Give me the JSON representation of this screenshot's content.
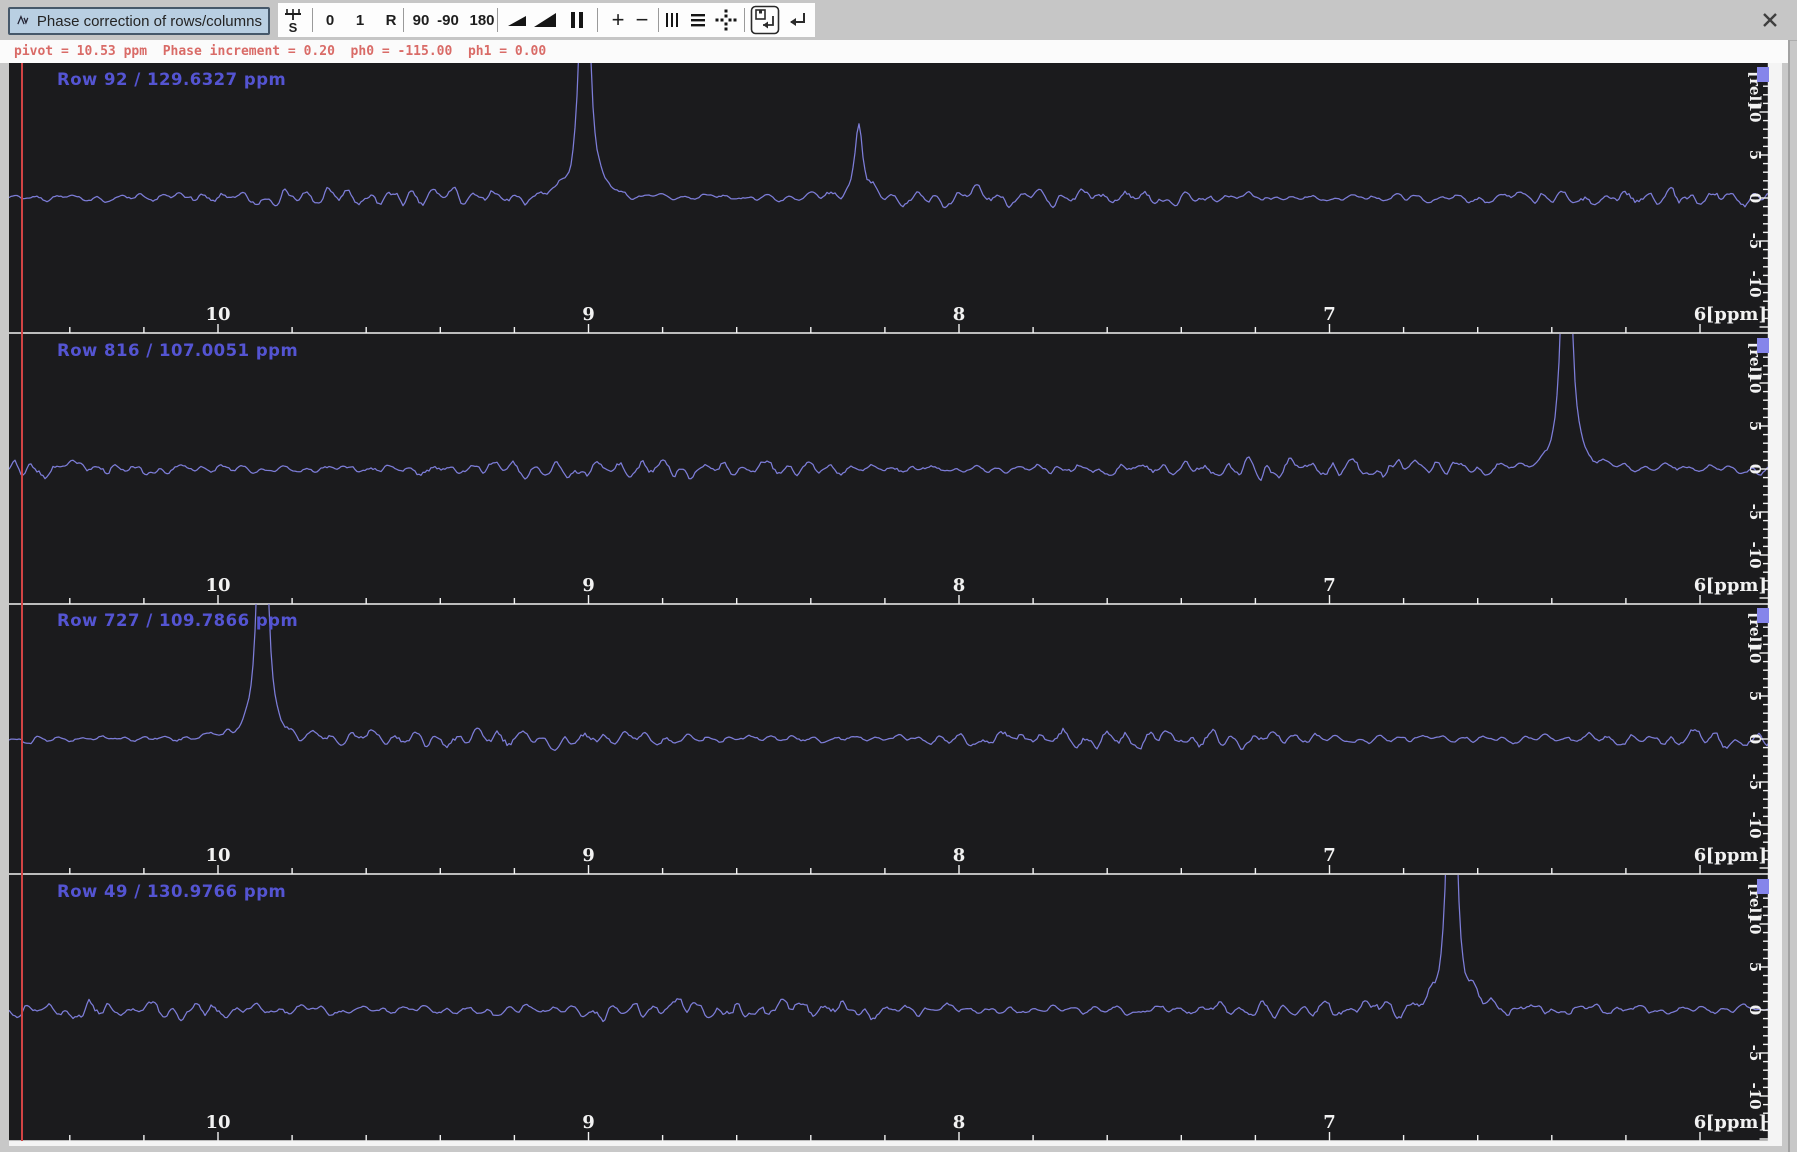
{
  "window": {
    "close_glyph": "✕"
  },
  "toolbar": {
    "phase_button": {
      "label": "Phase correction of rows/columns"
    },
    "pivot_icon_text": "S",
    "text_buttons": {
      "zero": "0",
      "one": "1",
      "r": "R",
      "p90": "90",
      "m90": "-90",
      "p180": "180",
      "plus": "+",
      "minus": "−"
    },
    "icon_buttons": [
      "phase-wave",
      "pivot-scale",
      "ramp-shallow",
      "ramp-steep",
      "pause",
      "vertical-lines",
      "horizontal-lines",
      "dot-grid",
      "save-return",
      "return",
      "close"
    ]
  },
  "status": {
    "text": "pivot = 10.53 ppm  Phase increment = 0.20  ph0 = -115.00  ph1 = 0.00"
  },
  "phase": {
    "pivot_ppm": 10.53
  },
  "axis": {
    "ppm_unit": "[ppm]",
    "rel_unit": "[rel]",
    "ppm_tick_labels": [
      "10",
      "9",
      "8",
      "7",
      "6"
    ],
    "rel_tick_labels": [
      "10",
      "5",
      "0",
      "-5",
      "-10"
    ]
  },
  "chart_data": {
    "type": "line",
    "x_axis": {
      "label": "[ppm]",
      "ticks": [
        10,
        9,
        8,
        7,
        6
      ],
      "minor_step": 0.2,
      "left_edge_ppm": 10.56,
      "right_edge_ppm": 5.83,
      "direction": "reversed"
    },
    "y_axis": {
      "label": "[rel]",
      "ticks": [
        10,
        5,
        0,
        -5,
        -10
      ],
      "minor_step": 1
    },
    "panels": [
      {
        "row_label": "Row 92 / 129.6327 ppm",
        "peaks": [
          {
            "ppm": 9.01,
            "rel": "clipped"
          },
          {
            "ppm": 8.27,
            "rel": 9
          }
        ],
        "noise_rel": 1.0,
        "seed": 7
      },
      {
        "row_label": "Row 816 / 107.0051 ppm",
        "peaks": [
          {
            "ppm": 6.36,
            "rel": "clipped"
          }
        ],
        "noise_rel": 1.1,
        "seed": 23
      },
      {
        "row_label": "Row 727 / 109.7866 ppm",
        "peaks": [
          {
            "ppm": 9.88,
            "rel": "clipped"
          }
        ],
        "noise_rel": 1.0,
        "seed": 41
      },
      {
        "row_label": "Row 49 / 130.9766 ppm",
        "peaks": [
          {
            "ppm": 6.67,
            "rel": "clipped"
          }
        ],
        "noise_rel": 1.1,
        "seed": 59
      }
    ]
  },
  "colors": {
    "trace": "#7d7dd8",
    "row_label": "#5454d2",
    "pivot_line": "#d14444",
    "status_text": "#d96b67",
    "plot_background": "#1b1b1d",
    "axis_text": "#f2f2f2",
    "phase_button_bg": "#b9cfe2",
    "marker": "#8585ea"
  }
}
